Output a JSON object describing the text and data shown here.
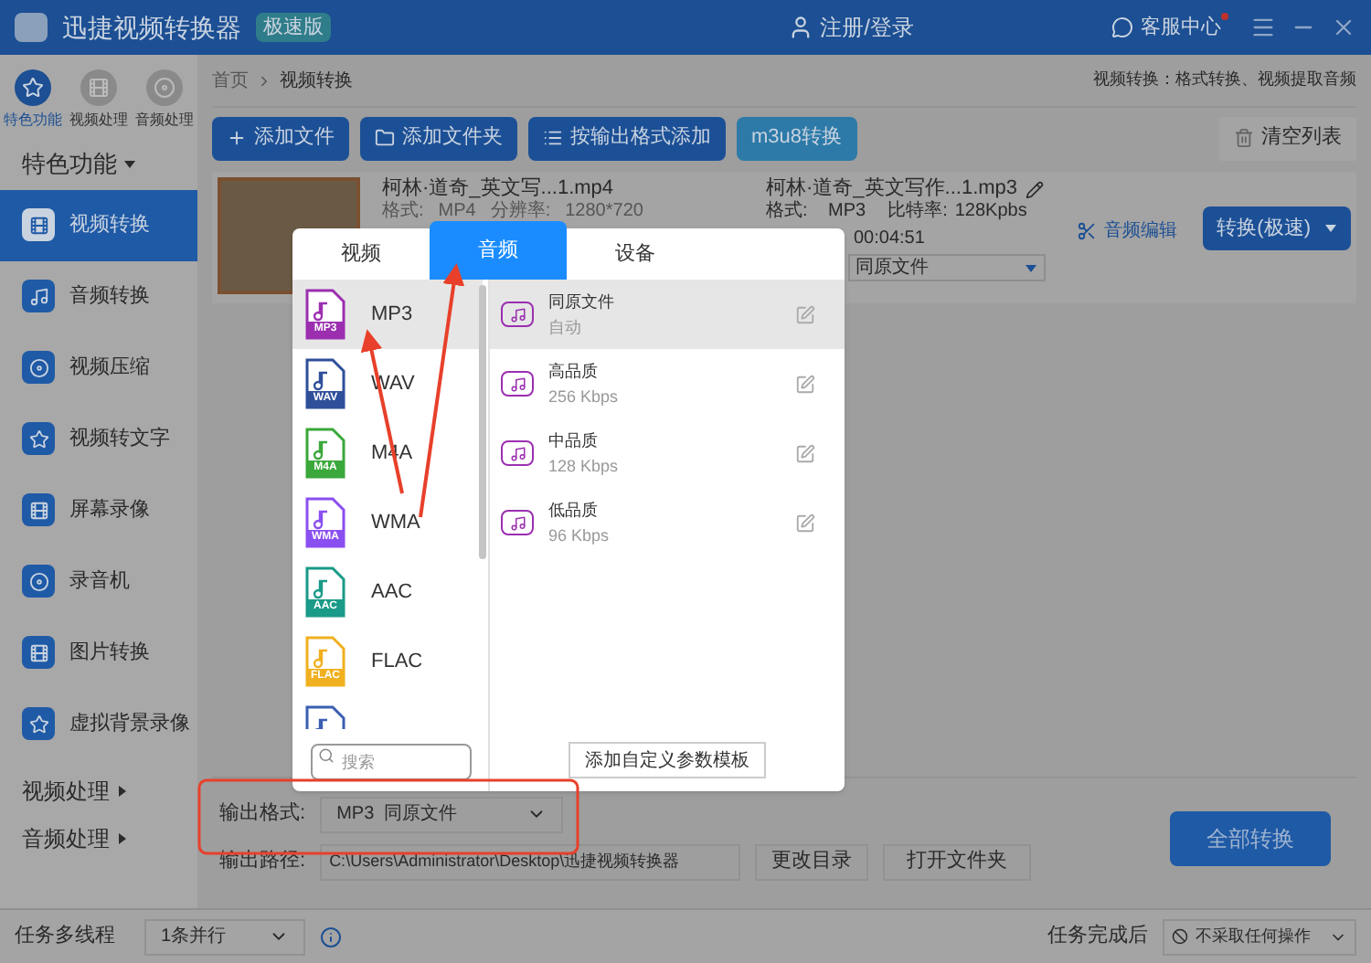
{
  "app": {
    "title": "迅捷视频转换器",
    "edition": "极速版",
    "login": "注册/登录",
    "support": "客服中心",
    "support_alert": true
  },
  "sidebar": {
    "top_tabs": [
      {
        "label": "特色功能",
        "selected": true
      },
      {
        "label": "视频处理",
        "selected": false
      },
      {
        "label": "音频处理",
        "selected": false
      }
    ],
    "section": "特色功能",
    "items": [
      {
        "label": "视频转换",
        "selected": true
      },
      {
        "label": "音频转换",
        "selected": false
      },
      {
        "label": "视频压缩",
        "selected": false
      },
      {
        "label": "视频转文字",
        "selected": false
      },
      {
        "label": "屏幕录像",
        "selected": false
      },
      {
        "label": "录音机",
        "selected": false
      },
      {
        "label": "图片转换",
        "selected": false
      },
      {
        "label": "虚拟背景录像",
        "selected": false
      }
    ],
    "groups": [
      {
        "label": "视频处理",
        "expanded": false
      },
      {
        "label": "音频处理",
        "expanded": false
      }
    ]
  },
  "breadcrumb": [
    "首页",
    "视频转换"
  ],
  "page_hint": "视频转换：格式转换、视频提取音频",
  "toolbar": {
    "buttons": [
      {
        "label": "添加文件",
        "kind": "add"
      },
      {
        "label": "添加文件夹",
        "kind": "folder"
      },
      {
        "label": "按输出格式添加",
        "kind": "list"
      },
      {
        "label": "m3u8转换",
        "kind": "plain"
      }
    ],
    "clear": "清空列表"
  },
  "file": {
    "source_name": "柯林·道奇_英文写...1.mp4",
    "source_format_label": "格式:",
    "source_format": "MP4",
    "source_resolution_label": "分辨率:",
    "source_resolution": "1280*720",
    "output_name": "柯林·道奇_英文写作...1.mp3",
    "output_format_label": "格式:",
    "output_format": "MP3",
    "bitrate_label": "比特率:",
    "bitrate": "128Kpbs",
    "duration": "00:04:51",
    "quality": "同原文件",
    "edit": "音频编辑",
    "convert": "转换(极速)"
  },
  "popup": {
    "tabs": [
      {
        "label": "视频",
        "selected": false
      },
      {
        "label": "音频",
        "selected": true
      },
      {
        "label": "设备",
        "selected": false
      }
    ],
    "formats": [
      {
        "label": "MP3",
        "badge": "MP3",
        "color": "#9b2fb0",
        "selected": true
      },
      {
        "label": "WAV",
        "badge": "WAV",
        "color": "#2f4f9a",
        "selected": false
      },
      {
        "label": "M4A",
        "badge": "M4A",
        "color": "#3aa83a",
        "selected": false
      },
      {
        "label": "WMA",
        "badge": "WMA",
        "color": "#8a4ff0",
        "selected": false
      },
      {
        "label": "AAC",
        "badge": "AAC",
        "color": "#1a9a88",
        "selected": false
      },
      {
        "label": "FLAC",
        "badge": "FLAC",
        "color": "#f0b020",
        "selected": false
      },
      {
        "color": "#3a5fb0",
        "selected": false
      }
    ],
    "presets": [
      {
        "title": "同原文件",
        "detail": "自动",
        "selected": true
      },
      {
        "title": "高品质",
        "detail": "256 Kbps",
        "selected": false
      },
      {
        "title": "中品质",
        "detail": "128 Kbps",
        "selected": false
      },
      {
        "title": "低品质",
        "detail": "96 Kbps",
        "selected": false
      }
    ],
    "search_placeholder": "搜索",
    "add_template": "添加自定义参数模板"
  },
  "output": {
    "format_label": "输出格式:",
    "format_value": "MP3  同原文件",
    "path_label": "输出路径:",
    "path": "C:\\Users\\Administrator\\Desktop\\迅捷视频转换器",
    "change_dir": "更改目录",
    "open_folder": "打开文件夹",
    "convert_all": "全部转换"
  },
  "status_bar": {
    "threads_label": "任务多线程",
    "threads_value": "1条并行",
    "after_label": "任务完成后",
    "after_value": "不采取任何操作"
  }
}
